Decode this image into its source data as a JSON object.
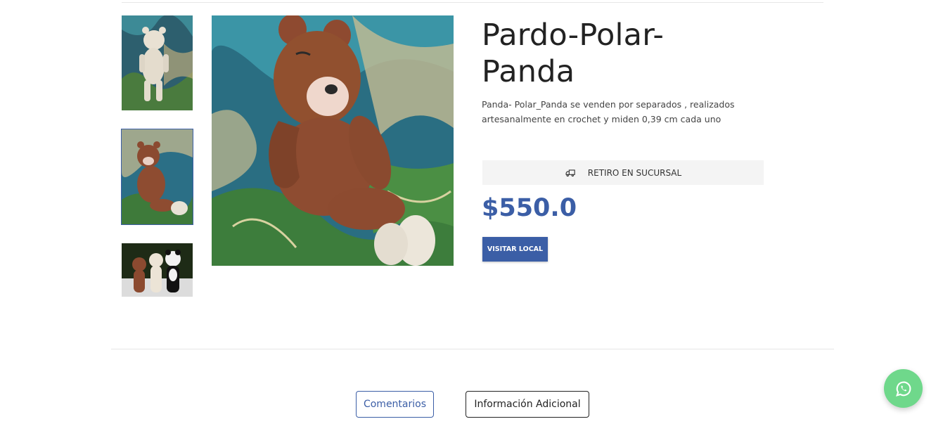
{
  "product": {
    "title": "Pardo-Polar-Panda",
    "description": "Panda- Polar_Panda se venden por separados , realizados artesanalmente en crochet y miden 0,39 cm cada uno",
    "shipping_label": "RETIRO EN SUCURSAL",
    "price": "$550.0",
    "visit_button": "VISITAR LOCAL"
  },
  "gallery": {
    "thumbnails": [
      "polar-bear-thumbnail",
      "brown-bear-thumbnail",
      "three-bears-thumbnail"
    ],
    "selected_index": 1
  },
  "tabs": [
    {
      "label": "Comentarios",
      "active": true
    },
    {
      "label": "Información Adicional",
      "active": false
    }
  ],
  "icons": {
    "shipping": "truck-icon",
    "whatsapp": "whatsapp-icon"
  },
  "colors": {
    "accent": "#3b5ea6",
    "whatsapp": "#6fd88b",
    "shipping_bg": "#f4f4f4"
  }
}
